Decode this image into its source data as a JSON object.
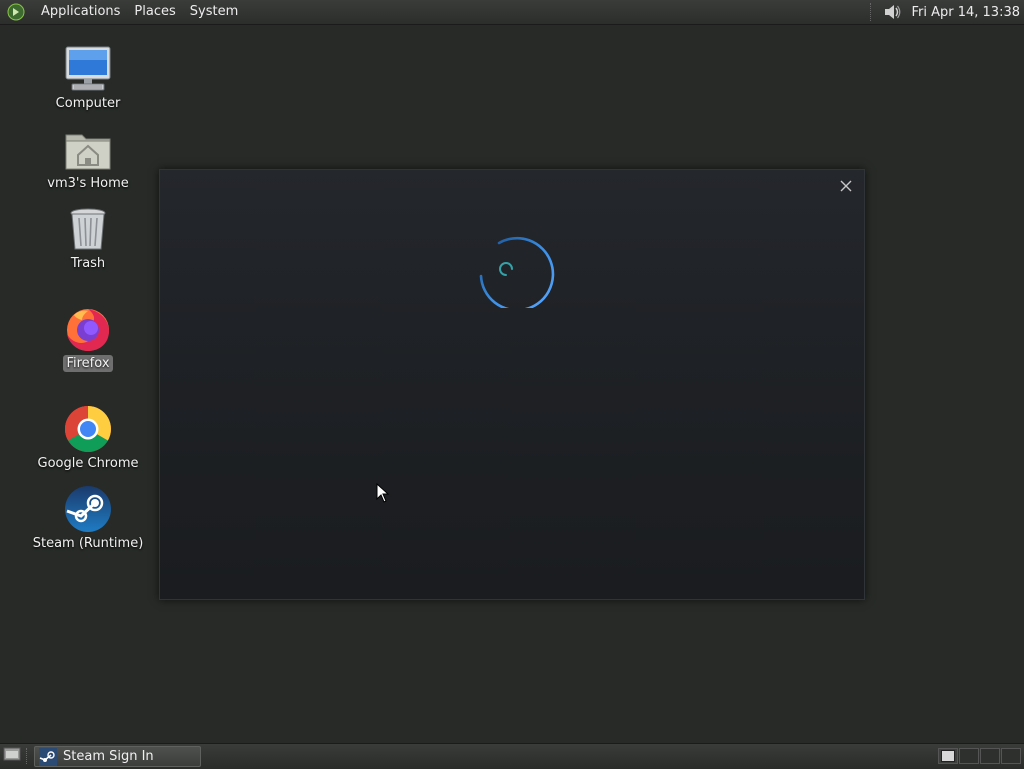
{
  "top_panel": {
    "menus": [
      "Applications",
      "Places",
      "System"
    ],
    "clock": "Fri Apr 14, 13:38",
    "icons": {
      "menu_logo": "gnome-foot-icon",
      "volume": "speaker-icon"
    }
  },
  "desktop_icons": [
    {
      "label": "Computer",
      "icon": "computer-icon"
    },
    {
      "label": "vm3's Home",
      "icon": "home-folder-icon"
    },
    {
      "label": "Trash",
      "icon": "trash-icon"
    },
    {
      "label": "Firefox",
      "icon": "firefox-icon",
      "selected": true
    },
    {
      "label": "Google Chrome",
      "icon": "chrome-icon"
    },
    {
      "label": "Steam (Runtime)",
      "icon": "steam-icon"
    }
  ],
  "steam_window": {
    "state": "loading",
    "icons": {
      "close": "close-icon",
      "spinner": "loading-spinner-icon"
    },
    "colors": {
      "spinner": "#3b8fe6",
      "spinner_inner": "#35a1a8"
    }
  },
  "bottom_panel": {
    "tasks": [
      {
        "label": "Steam Sign In",
        "icon": "steam-icon"
      }
    ],
    "workspaces": 4,
    "active_workspace": 1
  }
}
